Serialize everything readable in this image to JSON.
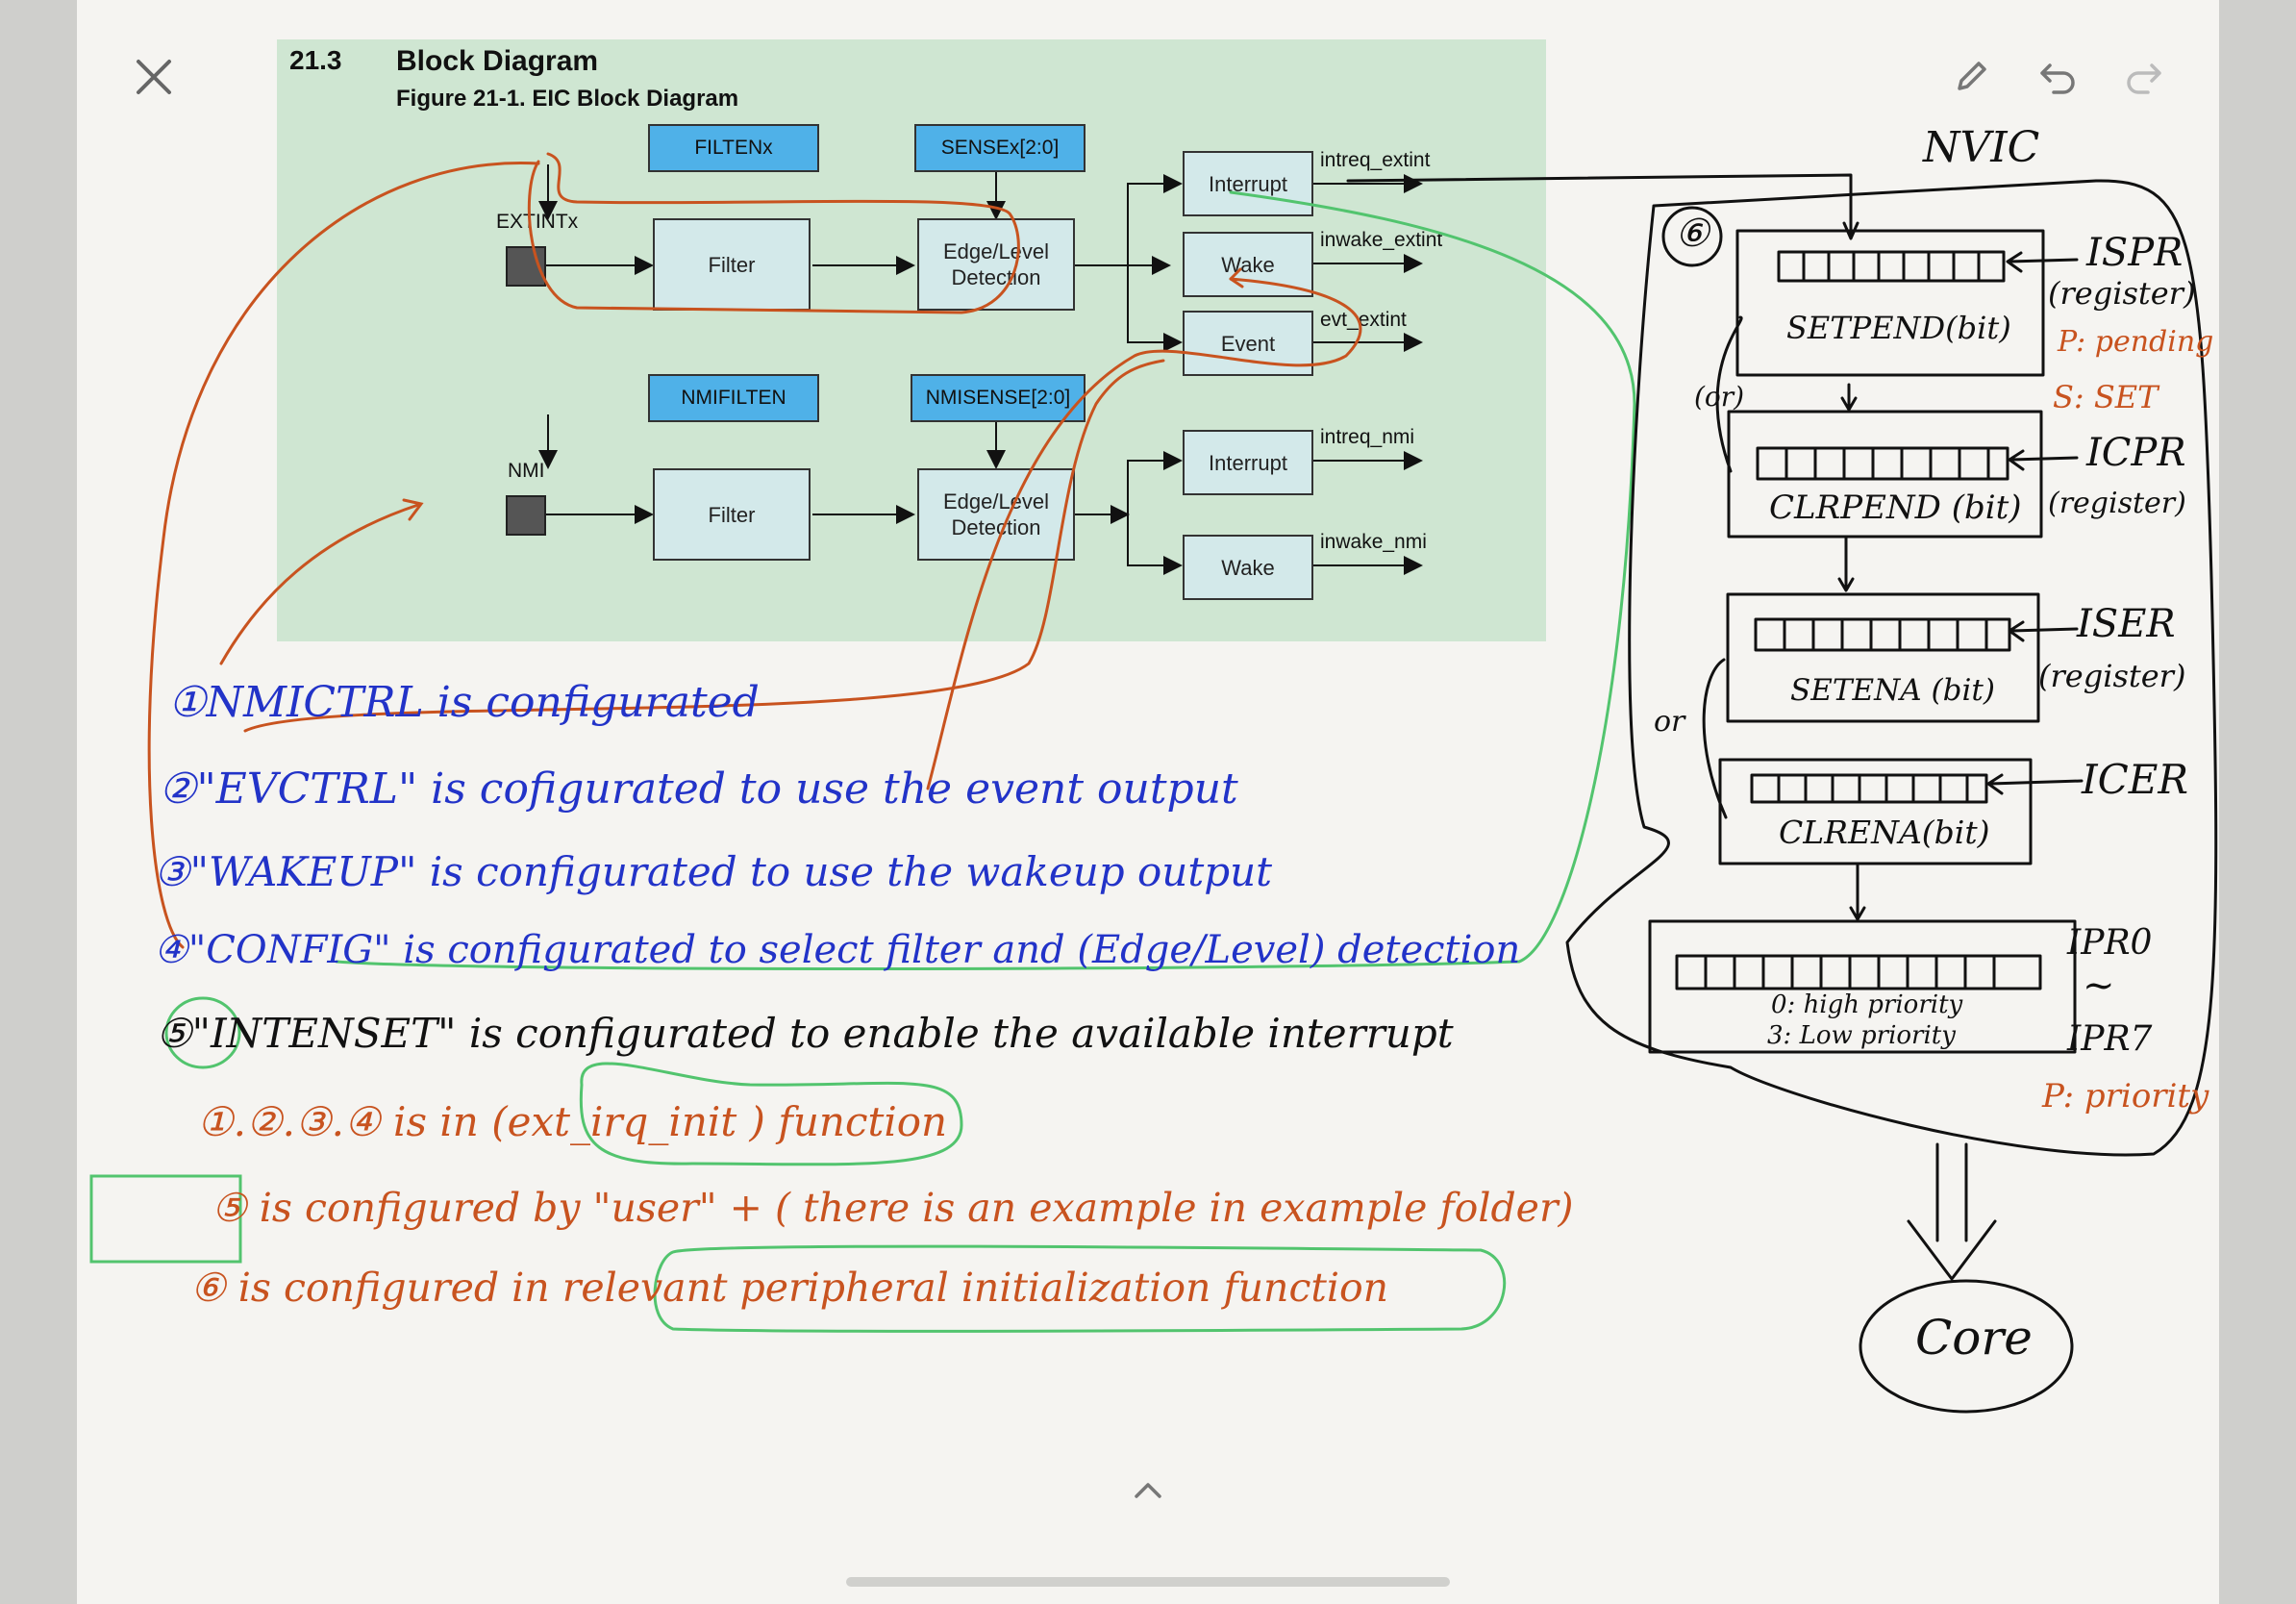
{
  "toolbar": {
    "close_icon": "close-icon",
    "pen_icon": "pen-icon",
    "undo_icon": "undo-icon",
    "redo_icon": "redo-icon",
    "collapse_icon": "chevron-up-icon"
  },
  "figure": {
    "section_number": "21.3",
    "section_title": "Block Diagram",
    "caption": "Figure 21-1. EIC Block Diagram",
    "ext": {
      "pin_label": "EXTINTx",
      "filter_reg": "FILTENx",
      "sense_reg": "SENSEx[2:0]",
      "filter_box": "Filter",
      "edge_line1": "Edge/Level",
      "edge_line2": "Detection",
      "out_interrupt": "Interrupt",
      "out_wake": "Wake",
      "out_event": "Event",
      "sig_interrupt": "intreq_extint",
      "sig_wake": "inwake_extint",
      "sig_event": "evt_extint"
    },
    "nmi": {
      "pin_label": "NMI",
      "filter_reg": "NMIFILTEN",
      "sense_reg": "NMISENSE[2:0]",
      "filter_box": "Filter",
      "edge_line1": "Edge/Level",
      "edge_line2": "Detection",
      "out_interrupt": "Interrupt",
      "out_wake": "Wake",
      "sig_interrupt": "intreq_nmi",
      "sig_wake": "inwake_nmi"
    }
  },
  "notes": {
    "n1": "①NMICTRL is configurated",
    "n2": "②\"EVCTRL\" is cofigurated to use the event output",
    "n3": "③\"WAKEUP\" is configurated to use the wakeup output",
    "n4": "④\"CONFIG\" is configurated to select filter and (Edge/Level) detection",
    "n5": "⑤\"INTENSET\" is configurated to enable the available interrupt",
    "n6_prefix": "①.②.③.④ is in",
    "n6_func": "(ext_irq_init )",
    "n6_suffix": "function",
    "n7": "⑤ is configured by \"user\" + ( there is an example in example folder)",
    "n8_prefix": "⑥ is configured in",
    "n8_func": "relevant peripheral initialization function"
  },
  "nvic": {
    "title": "NVIC",
    "group_marker": "⑥",
    "setpend": "SETPEND(bit)",
    "clrpend": "CLRPEND (bit)",
    "setena": "SETENA (bit)",
    "clrena": "CLRENA(bit)",
    "ispr": "ISPR",
    "ispr_note": "(register)",
    "icpr": "ICPR",
    "icpr_note": "(register)",
    "iser": "ISER",
    "iser_note": "(register)",
    "icer": "ICER",
    "or_1": "(or)",
    "or_2": "or",
    "p_pending": "P: pending",
    "s_set": "S: SET",
    "prio_high": "0: high priority",
    "prio_low": "3: Low priority",
    "ipr0": "IPR0",
    "tilde": "~",
    "ipr7": "IPR7",
    "p_priority": "P: priority",
    "core": "Core"
  },
  "colors": {
    "page": "#f5f4f1",
    "figure_bg": "#cfe6d2",
    "register_box": "#4fb1e8",
    "block_box": "#d3e9ea",
    "ink_blue": "#2233c8",
    "ink_orange": "#c8531f",
    "ink_green": "#52c46e",
    "ink_black": "#111111"
  }
}
